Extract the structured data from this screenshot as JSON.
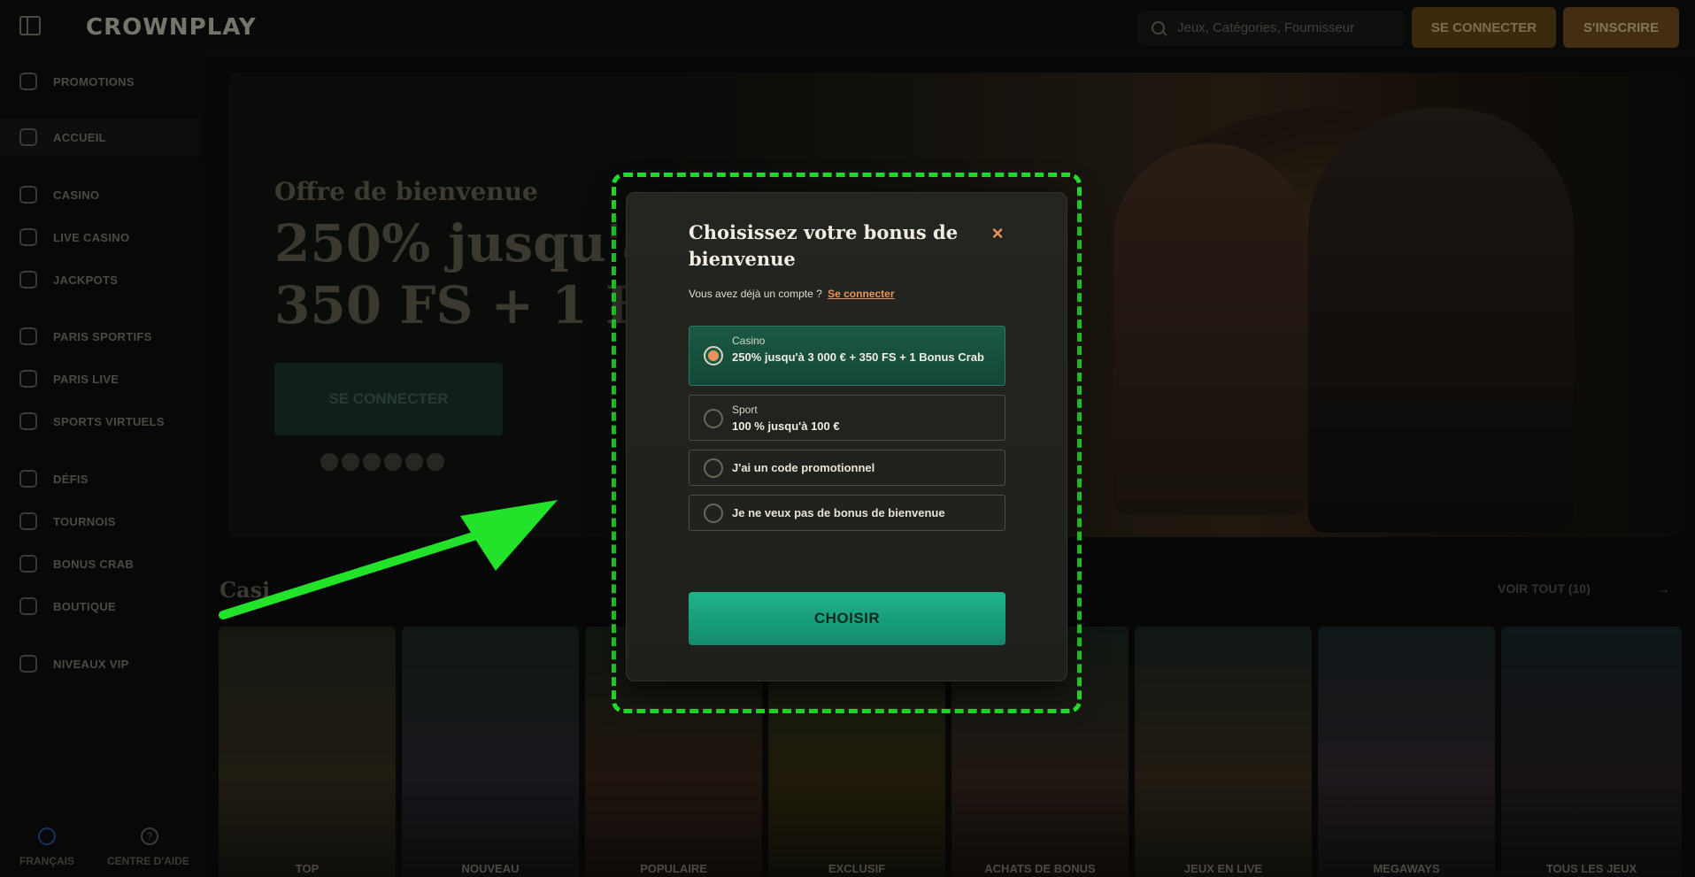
{
  "header": {
    "logo": "CROWNPLAY",
    "search_placeholder": "Jeux, Catégories, Fournisseur",
    "login_label": "SE CONNECTER",
    "signup_label": "S'INSCRIRE"
  },
  "sidebar": {
    "items": [
      {
        "label": "PROMOTIONS",
        "icon": "gift-icon"
      },
      {
        "label": "ACCUEIL",
        "icon": "home-icon",
        "active": true
      },
      {
        "label": "CASINO",
        "icon": "slot-icon"
      },
      {
        "label": "LIVE CASINO",
        "icon": "spade-icon"
      },
      {
        "label": "JACKPOTS",
        "icon": "jackpot-icon"
      },
      {
        "label": "PARIS SPORTIFS",
        "icon": "ball-icon"
      },
      {
        "label": "PARIS LIVE",
        "icon": "live-icon"
      },
      {
        "label": "SPORTS VIRTUELS",
        "icon": "virtual-icon"
      },
      {
        "label": "DÉFIS",
        "icon": "challenge-icon"
      },
      {
        "label": "TOURNOIS",
        "icon": "trophy-icon"
      },
      {
        "label": "BONUS CRAB",
        "icon": "crab-icon"
      },
      {
        "label": "BOUTIQUE",
        "icon": "shop-icon"
      },
      {
        "label": "NIVEAUX VIP",
        "icon": "vip-icon"
      }
    ],
    "language_label": "FRANÇAIS",
    "help_label": "CENTRE D'AIDE"
  },
  "hero": {
    "subtitle": "Offre de bienvenue",
    "title_line1": "250% jusqu'à 3",
    "title_line2": "350 FS + 1 Bo",
    "button_label": "SE CONNECTER"
  },
  "section": {
    "title": "Casi",
    "view_all": "VOIR TOUT (10)"
  },
  "games": [
    {
      "label": "TOP"
    },
    {
      "label": "NOUVEAU"
    },
    {
      "label": "POPULAIRE"
    },
    {
      "label": "EXCLUSIF"
    },
    {
      "label": "ACHATS DE BONUS"
    },
    {
      "label": "JEUX EN LIVE"
    },
    {
      "label": "MEGAWAYS"
    },
    {
      "label": "TOUS LES JEUX"
    }
  ],
  "modal": {
    "title": "Choisissez votre bonus de bienvenue",
    "have_account_text": "Vous avez déjà un compte ?",
    "login_link": "Se connecter",
    "options": [
      {
        "category": "Casino",
        "value": "250% jusqu'à 3 000 € + 350 FS + 1 Bonus Crab",
        "selected": true
      },
      {
        "category": "Sport",
        "value": "100 % jusqu'à 100 €",
        "selected": false
      },
      {
        "label": "J'ai un code promotionnel",
        "selected": false
      },
      {
        "label": "Je ne veux pas de bonus de bienvenue",
        "selected": false
      }
    ],
    "choose_label": "CHOISIR",
    "close_icon": "×"
  },
  "colors": {
    "accent_orange": "#e8945a",
    "accent_green": "#1fb48b",
    "highlight_dash": "#22e22a"
  }
}
